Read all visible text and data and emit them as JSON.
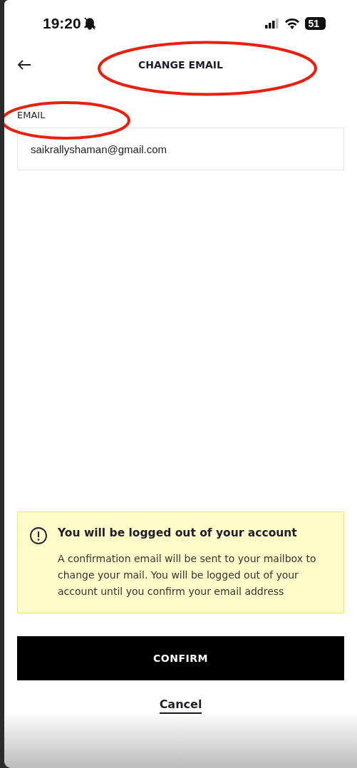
{
  "status_bar": {
    "time": "19:20",
    "battery": "51"
  },
  "header": {
    "title": "CHANGE EMAIL"
  },
  "email_field": {
    "label": "EMAIL",
    "value": "saikrallyshaman@gmail.com"
  },
  "notice": {
    "title": "You will be logged out of your account",
    "body": "A confirmation email will be sent to your mailbox to change your mail. You will be logged out of your account until you confirm your email address"
  },
  "buttons": [
    {
      "kind": "primary",
      "label": "CONFIRM"
    },
    {
      "kind": "link",
      "label": "Cancel"
    }
  ]
}
